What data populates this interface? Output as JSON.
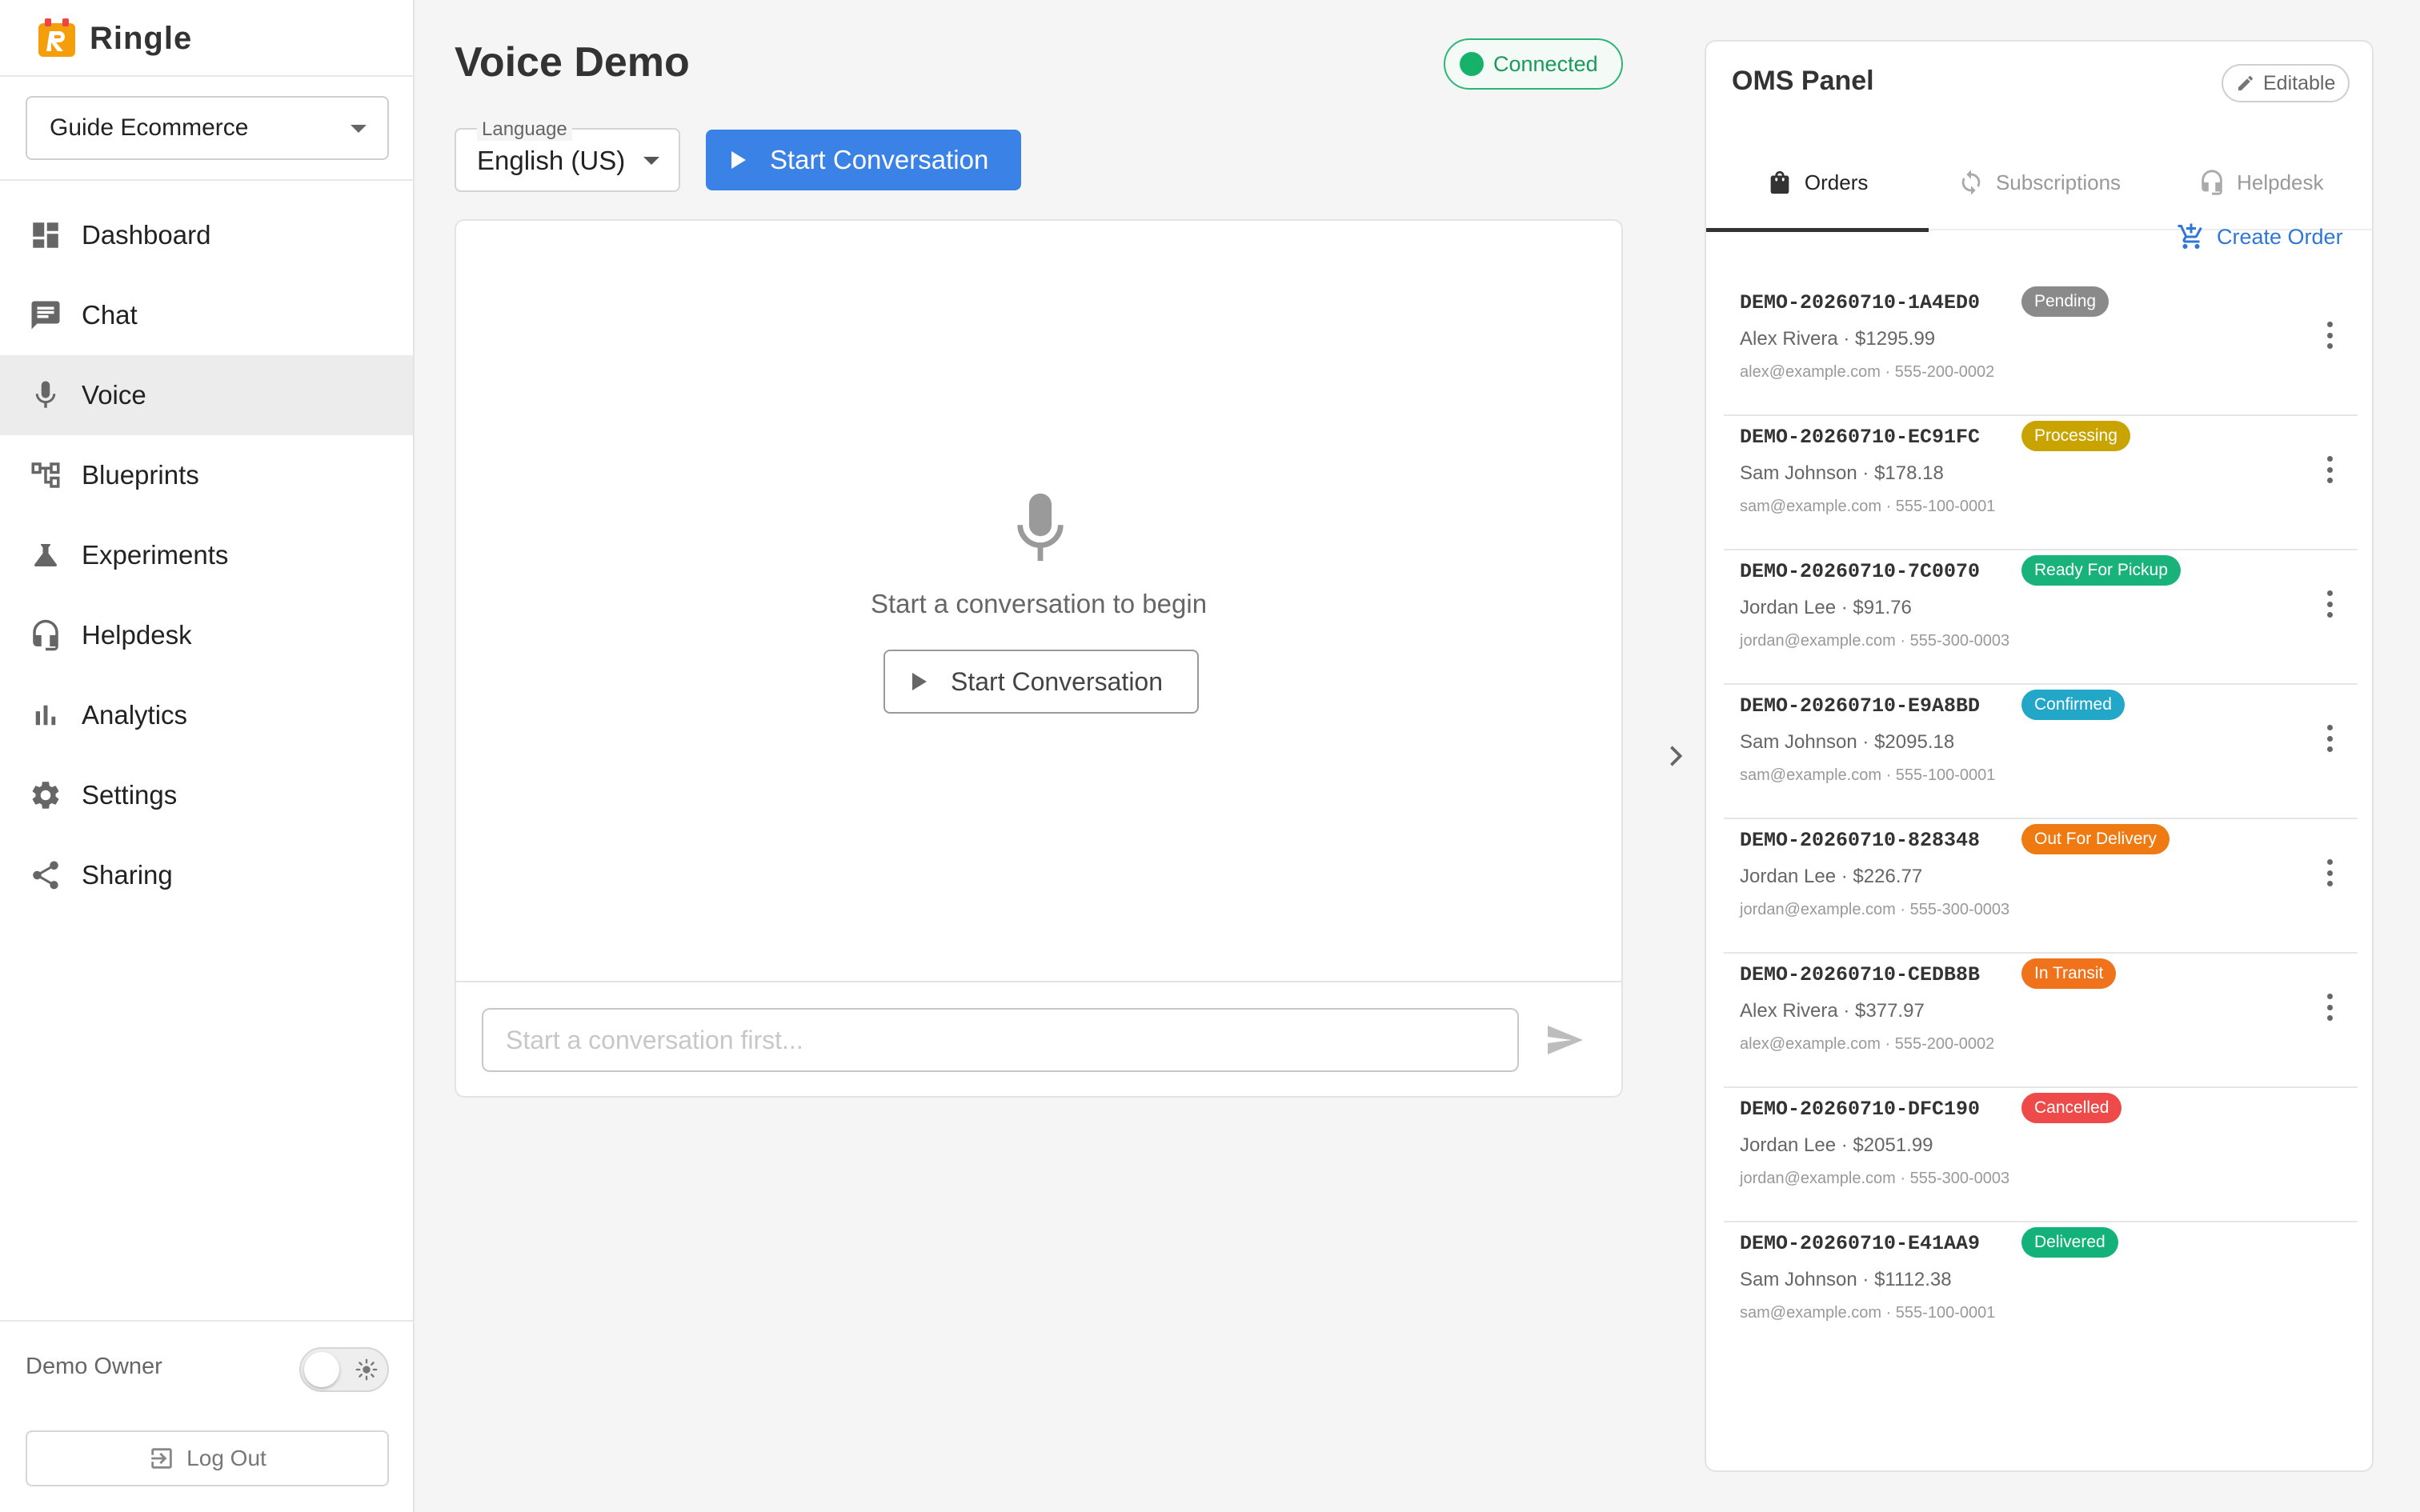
{
  "app": {
    "brand_name": "Ringle",
    "brand_color": "#f59e0b"
  },
  "sidebar": {
    "workspace": "Guide Ecommerce",
    "items": [
      {
        "label": "Dashboard",
        "icon": "dashboard-icon"
      },
      {
        "label": "Chat",
        "icon": "chat-icon"
      },
      {
        "label": "Voice",
        "icon": "mic-icon",
        "active": true
      },
      {
        "label": "Blueprints",
        "icon": "blueprint-icon"
      },
      {
        "label": "Experiments",
        "icon": "flask-icon"
      },
      {
        "label": "Helpdesk",
        "icon": "headset-icon"
      },
      {
        "label": "Analytics",
        "icon": "bar-chart-icon"
      },
      {
        "label": "Settings",
        "icon": "gear-icon"
      },
      {
        "label": "Sharing",
        "icon": "share-icon"
      }
    ],
    "owner_label": "Demo Owner",
    "logout_label": "Log Out"
  },
  "main": {
    "title": "Voice Demo",
    "status": "Connected",
    "language_label": "Language",
    "language_value": "English (US)",
    "start_label": "Start Conversation",
    "empty_text": "Start a conversation to begin",
    "empty_button": "Start Conversation",
    "input_placeholder": "Start a conversation first..."
  },
  "oms": {
    "title": "OMS Panel",
    "editable_label": "Editable",
    "tabs": [
      {
        "label": "Orders",
        "icon": "bag-icon",
        "active": true
      },
      {
        "label": "Subscriptions",
        "icon": "refresh-icon"
      },
      {
        "label": "Helpdesk",
        "icon": "headset-icon"
      }
    ],
    "create_order_label": "Create Order",
    "orders": [
      {
        "id": "DEMO-20260710-1A4ED0",
        "status": "Pending",
        "color": "#8a8a8a",
        "customer": "Alex Rivera · $1295.99",
        "contact": "alex@example.com · 555-200-0002"
      },
      {
        "id": "DEMO-20260710-EC91FC",
        "status": "Processing",
        "color": "#c9a400",
        "customer": "Sam Johnson · $178.18",
        "contact": "sam@example.com · 555-100-0001"
      },
      {
        "id": "DEMO-20260710-7C0070",
        "status": "Ready For Pickup",
        "color": "#19b27a",
        "customer": "Jordan Lee · $91.76",
        "contact": "jordan@example.com · 555-300-0003"
      },
      {
        "id": "DEMO-20260710-E9A8BD",
        "status": "Confirmed",
        "color": "#22a7c9",
        "customer": "Sam Johnson · $2095.18",
        "contact": "sam@example.com · 555-100-0001"
      },
      {
        "id": "DEMO-20260710-828348",
        "status": "Out For Delivery",
        "color": "#f07a12",
        "customer": "Jordan Lee · $226.77",
        "contact": "jordan@example.com · 555-300-0003"
      },
      {
        "id": "DEMO-20260710-CEDB8B",
        "status": "In Transit",
        "color": "#f0721a",
        "customer": "Alex Rivera · $377.97",
        "contact": "alex@example.com · 555-200-0002"
      },
      {
        "id": "DEMO-20260710-DFC190",
        "status": "Cancelled",
        "color": "#ef4a4a",
        "customer": "Jordan Lee · $2051.99",
        "contact": "jordan@example.com · 555-300-0003"
      },
      {
        "id": "DEMO-20260710-E41AA9",
        "status": "Delivered",
        "color": "#14b27b",
        "customer": "Sam Johnson · $1112.38",
        "contact": "sam@example.com · 555-100-0001"
      }
    ]
  }
}
